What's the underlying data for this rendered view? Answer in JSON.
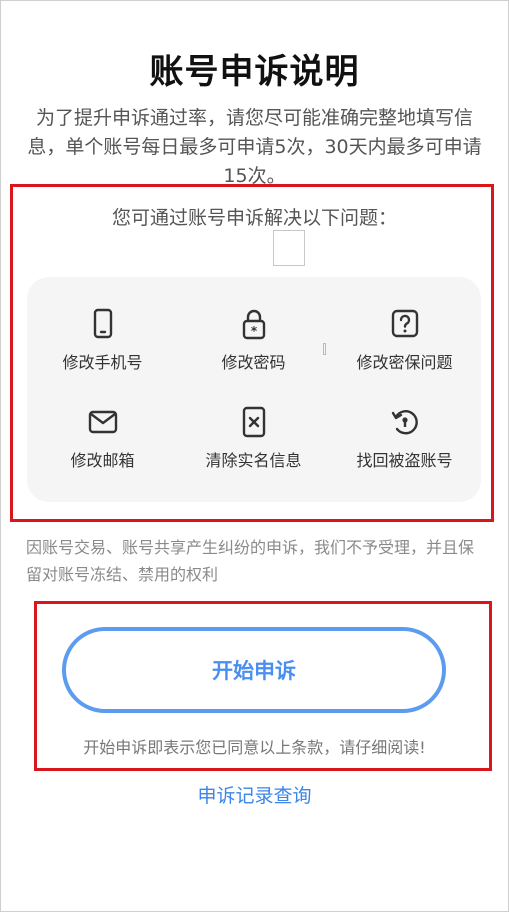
{
  "page": {
    "title": "账号申诉说明",
    "intro": "为了提升申诉通过率，请您尽可能准确完整地填写信息，单个账号每日最多可申请5次，30天内最多可申请15次。",
    "subtitle": "您可通过账号申诉解决以下问题："
  },
  "problems": {
    "items": [
      {
        "label": "修改手机号",
        "icon": "phone-icon"
      },
      {
        "label": "修改密码",
        "icon": "lock-icon"
      },
      {
        "label": "修改密保问题",
        "icon": "question-icon"
      },
      {
        "label": "修改邮箱",
        "icon": "mail-icon"
      },
      {
        "label": "清除实名信息",
        "icon": "id-clear-icon"
      },
      {
        "label": "找回被盗账号",
        "icon": "recover-icon"
      }
    ]
  },
  "notice": "因账号交易、账号共享产生纠纷的申诉，我们不予受理，并且保留对账号冻结、禁用的权利",
  "actions": {
    "start_label": "开始申诉",
    "agree_text": "开始申诉即表示您已同意以上条款，请仔细阅读!",
    "record_link": "申诉记录查询"
  },
  "colors": {
    "accent": "#4a8ff0",
    "highlight_border": "#d9161c",
    "panel_bg": "#f5f5f5"
  }
}
